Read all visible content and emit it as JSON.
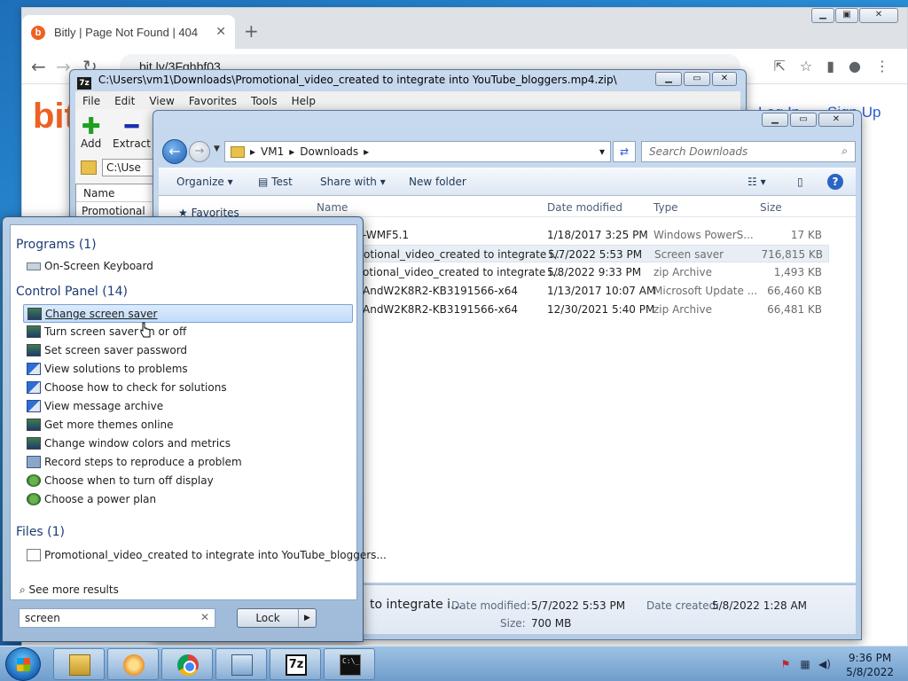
{
  "chrome": {
    "tab_title": "Bitly | Page Not Found | 404",
    "url": "bit.ly/3Fghbf03",
    "logo": "bit",
    "login": "Log In",
    "signup": "Sign Up"
  },
  "sevenzip": {
    "title": "C:\\Users\\vm1\\Downloads\\Promotional_video_created to integrate into YouTube_bloggers.mp4.zip\\",
    "app_icon": "7z",
    "menu": [
      "File",
      "Edit",
      "View",
      "Favorites",
      "Tools",
      "Help"
    ],
    "tools": {
      "add": "Add",
      "extract": "Extract"
    },
    "address": "C:\\Use",
    "column_name": "Name",
    "row": "Promotional"
  },
  "explorer": {
    "breadcrumb": [
      "VM1",
      "Downloads"
    ],
    "search_placeholder": "Search Downloads",
    "commands": {
      "organize": "Organize",
      "test": "Test",
      "share_with": "Share with",
      "new_folder": "New folder"
    },
    "columns": {
      "name": "Name",
      "date": "Date modified",
      "type": "Type",
      "size": "Size"
    },
    "favorites": "Favorites",
    "files": [
      {
        "name": "-WMF5.1",
        "date": "1/18/2017 3:25 PM",
        "type": "Windows PowerS...",
        "size": "17 KB"
      },
      {
        "name": "otional_video_created to integrate i...",
        "date": "5/7/2022 5:53 PM",
        "type": "Screen saver",
        "size": "716,815 KB"
      },
      {
        "name": "otional_video_created to integrate i...",
        "date": "5/8/2022 9:33 PM",
        "type": "zip Archive",
        "size": "1,493 KB"
      },
      {
        "name": "AndW2K8R2-KB3191566-x64",
        "date": "1/13/2017 10:07 AM",
        "type": "Microsoft Update ...",
        "size": "66,460 KB"
      },
      {
        "name": "AndW2K8R2-KB3191566-x64",
        "date": "12/30/2021 5:40 PM",
        "type": "zip Archive",
        "size": "66,481 KB"
      }
    ],
    "details": {
      "name": "to integrate i...",
      "date_modified_label": "Date modified:",
      "date_modified": "5/7/2022 5:53 PM",
      "date_created_label": "Date created:",
      "date_created": "5/8/2022 1:28 AM",
      "size_label": "Size:",
      "size": "700 MB"
    }
  },
  "startmenu": {
    "programs_header": "Programs (1)",
    "programs": [
      {
        "label": "On-Screen Keyboard",
        "icon": "keyboard-icon"
      }
    ],
    "control_panel_header": "Control Panel (14)",
    "control_panel": [
      {
        "label": "Change screen saver",
        "icon": "monitor-icon"
      },
      {
        "label": "Turn screen saver on or off",
        "icon": "monitor-icon"
      },
      {
        "label": "Set screen saver password",
        "icon": "monitor-icon"
      },
      {
        "label": "View solutions to problems",
        "icon": "flag-icon"
      },
      {
        "label": "Choose how to check for solutions",
        "icon": "flag-icon"
      },
      {
        "label": "View message archive",
        "icon": "flag-icon"
      },
      {
        "label": "Get more themes online",
        "icon": "monitor-icon"
      },
      {
        "label": "Change window colors and metrics",
        "icon": "monitor-icon"
      },
      {
        "label": "Record steps to reproduce a problem",
        "icon": "steps-recorder-icon"
      },
      {
        "label": "Choose when to turn off display",
        "icon": "power-icon"
      },
      {
        "label": "Choose a power plan",
        "icon": "power-icon"
      }
    ],
    "files_header": "Files (1)",
    "files": [
      {
        "label": "Promotional_video_created to integrate into YouTube_bloggers...",
        "icon": "file-icon"
      }
    ],
    "see_more": "See more results",
    "search_value": "screen",
    "lock": "Lock"
  },
  "taskbar": {
    "clock_time": "9:36 PM",
    "clock_date": "5/8/2022",
    "sevenzip_label": "7z",
    "cmd_label": "C:\\_"
  }
}
